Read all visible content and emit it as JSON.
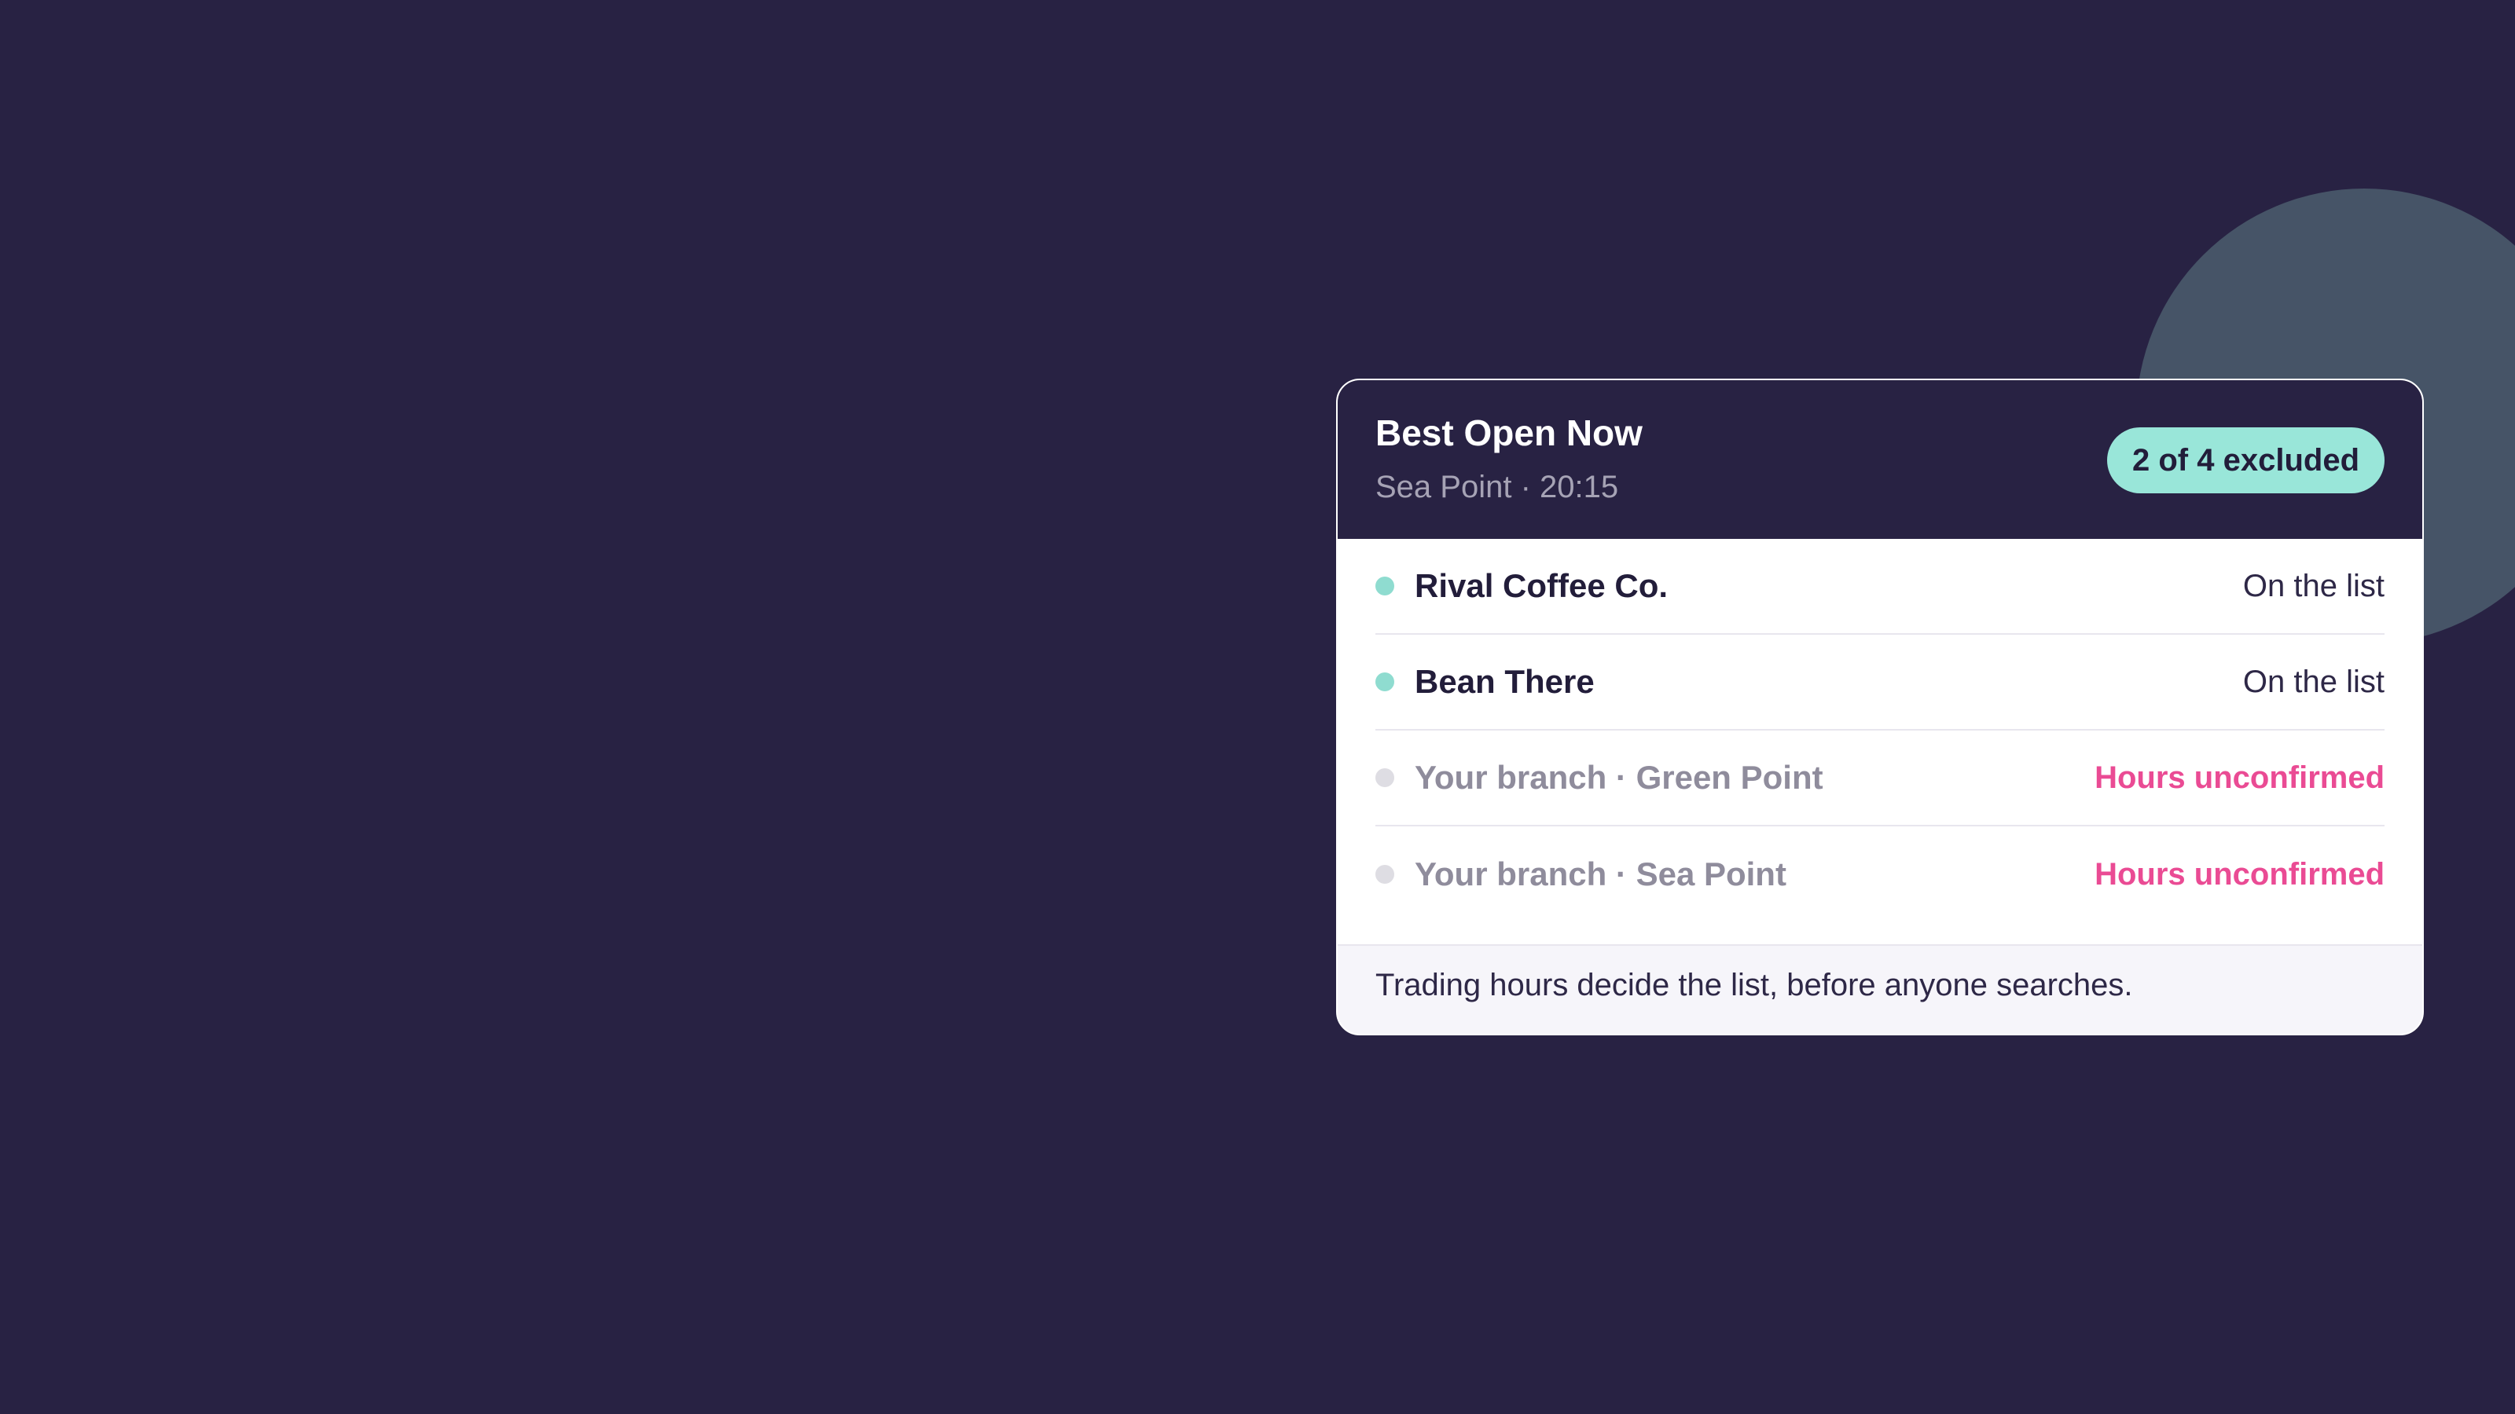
{
  "card": {
    "title": "Best Open Now",
    "subtitle": "Sea Point · 20:15",
    "badge": "2 of 4 excluded",
    "rows": [
      {
        "name": "Rival Coffee Co.",
        "status": "On the list",
        "state": "included"
      },
      {
        "name": "Bean There",
        "status": "On the list",
        "state": "included"
      },
      {
        "name": "Your branch · Green Point",
        "status": "Hours unconfirmed",
        "state": "excluded"
      },
      {
        "name": "Your branch · Sea Point",
        "status": "Hours unconfirmed",
        "state": "excluded"
      }
    ],
    "footer": "Trading hours decide the list, before anyone searches."
  },
  "colors": {
    "background": "#282243",
    "accent_teal": "#99e6d9",
    "warning_pink": "#ea4b94",
    "decor_circle": "#465467"
  }
}
